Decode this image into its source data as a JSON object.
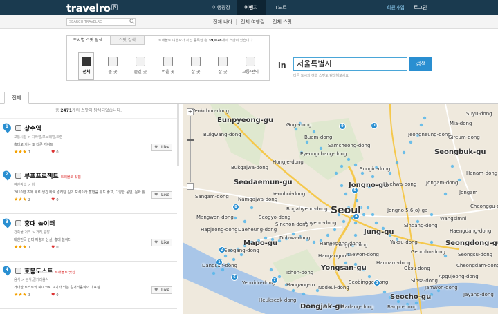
{
  "header": {
    "logo": "travelro",
    "logo_badge": "β",
    "nav": [
      "여행광장",
      "여행지",
      "T노트"
    ],
    "active_nav": "여행지",
    "signup": "회원가입",
    "login": "로그인"
  },
  "subheader": {
    "search_placeholder": "SEARCH TRAVELRO",
    "links": [
      "전체 나라",
      "전체 여행길",
      "전체 스팟"
    ]
  },
  "filter": {
    "tabs": [
      "도시별 스팟 탐색",
      "스팟 검색"
    ],
    "note_prefix": "트래블로 여행자가 직접 등록한 총 ",
    "note_count": "39,028",
    "note_suffix": "개의 스팟이 있습니다",
    "categories": [
      "전체",
      "볼 곳",
      "즐길 곳",
      "먹을 곳",
      "살 곳",
      "잘 곳",
      "교통/편의"
    ],
    "selected_category": "전체",
    "in_label": "in",
    "city_value": "서울특별시",
    "search_button": "검색",
    "city_hint": "다른 도시의 여행 스팟도 탐색해보세요"
  },
  "results": {
    "tab_label": "전체",
    "count_prefix": "총 ",
    "count": "2471",
    "count_suffix": "개의 스팟이 탐색되었습니다.",
    "like_label": "Like",
    "items": [
      {
        "num": "1",
        "title": "상수역",
        "badge": "",
        "category": "교통시설 > 지하철,모노레일,트램",
        "desc": "홍대로 가는 또 다른 게이트",
        "stars": "★★★",
        "rating": "1",
        "hearts": "0"
      },
      {
        "num": "2",
        "title": "루프프로젝트",
        "badge": "트래블로 맛집",
        "category": "여관광소 > 바",
        "desc": "2010년 초에 새로 생긴 바로 경리단 길의 보석이라 할만큼 뷰도 좋고, 다양한 공연, 문화 활",
        "stars": "★★★",
        "rating": "2",
        "hearts": "0"
      },
      {
        "num": "3",
        "title": "홍대 놀이터",
        "badge": "",
        "category": "건축물,거리 > 거리,광장",
        "desc": "대한민국 인디 예술의 산실, 홍대 놀이터",
        "stars": "★★★",
        "rating": "1",
        "hearts": "0"
      },
      {
        "num": "4",
        "title": "호봉도스트",
        "badge": "트래블로 맛집",
        "category": "음식 > 분식,길거리음식",
        "desc": "거대한 토스트와 쉐이크로 요기가 되는 길거리음식의 대표점",
        "stars": "★★★",
        "rating": "3",
        "hearts": "0"
      }
    ]
  },
  "map": {
    "labels": [
      "Yeokchon-dong",
      "Eunpyeong-gu",
      "Bulgwang-dong",
      "Bukgajwa-dong",
      "Hongje-dong",
      "Seodaemun-gu",
      "Namgajwa-dong",
      "Yeonhui-dong",
      "Bugahyeon-dong",
      "Sangam-dong",
      "Mangwon-dong",
      "Hapjeong-dong",
      "Seogyo-dong",
      "Sinchon-dong",
      "Ahyeon-dong",
      "Daeheung-dong",
      "Dohwa-dong",
      "Mapo-gu",
      "Yongsan-gu",
      "Hangangno-dong",
      "Ichon-dong",
      "Dangsan-dong",
      "Yeouido-dong",
      "Hangang-ro",
      "Nodeul-dong",
      "Dongjak-gu",
      "Seogang-dong",
      "Heukseok-dong",
      "Seoul",
      "Gugi-dong",
      "Buam-dong",
      "Samcheong-dong",
      "Pyeongchang-dong",
      "Jongno-gu",
      "Hyehwa-dong",
      "Seongbuk-gu",
      "Jeongneung-dong",
      "Gireum-dong",
      "Jongam-dong",
      "Sungin-dong",
      "Jongno 5.6(o)-ga",
      "Sindang-dong",
      "Yaksu-dong",
      "Jung-gu",
      "Geumho-dong",
      "Seongdong-gu",
      "Oksu-dong",
      "Hannam-dong",
      "Itaewon-dong",
      "Seobinggo-dong",
      "Banpo-dong",
      "Seocho-gu",
      "Sadang-dong",
      "Jamwon-dong",
      "Apgujeong-dong",
      "Sinsa-dong",
      "Cheongdam-dong",
      "Seongsu-dong",
      "Haengdang-dong",
      "Hangangno",
      "Jongam",
      "Hanam-dong",
      "Mia-dong",
      "Suyu-dong",
      "Jayang-dong",
      "Wangsimni",
      "Cheonggu-dong",
      "Cheongpa-dong"
    ],
    "pin_numbers": [
      "1",
      "2",
      "3",
      "4",
      "5",
      "6",
      "7",
      "8",
      "9",
      "10"
    ],
    "zoom_in": "+",
    "zoom_out": "−"
  }
}
